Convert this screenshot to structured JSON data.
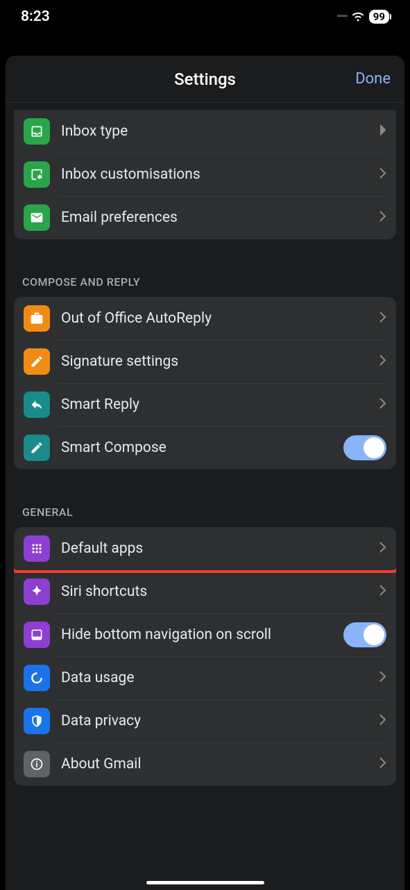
{
  "status": {
    "time": "8:23",
    "battery": "99"
  },
  "header": {
    "title": "Settings",
    "done": "Done"
  },
  "groups": [
    {
      "header": null,
      "items": [
        {
          "label": "Inbox type",
          "icon": "inbox-type",
          "color": "#2aa54a",
          "accessory": "chevron"
        },
        {
          "label": "Inbox customisations",
          "icon": "inbox-customisations",
          "color": "#2aa54a",
          "accessory": "chevron"
        },
        {
          "label": "Email preferences",
          "icon": "email",
          "color": "#2aa54a",
          "accessory": "chevron"
        }
      ]
    },
    {
      "header": "COMPOSE AND REPLY",
      "items": [
        {
          "label": "Out of Office AutoReply",
          "icon": "briefcase",
          "color": "#f08c16",
          "accessory": "chevron"
        },
        {
          "label": "Signature settings",
          "icon": "pen",
          "color": "#f08c16",
          "accessory": "chevron"
        },
        {
          "label": "Smart Reply",
          "icon": "reply",
          "color": "#1a8a8a",
          "accessory": "chevron"
        },
        {
          "label": "Smart Compose",
          "icon": "compose",
          "color": "#1a8a8a",
          "accessory": "toggle",
          "toggle_on": true
        }
      ]
    },
    {
      "header": "GENERAL",
      "items": [
        {
          "label": "Default apps",
          "icon": "apps-grid",
          "color": "#8c3fd0",
          "accessory": "chevron",
          "highlighted": true
        },
        {
          "label": "Siri shortcuts",
          "icon": "siri",
          "color": "#8c3fd0",
          "accessory": "chevron"
        },
        {
          "label": "Hide bottom navigation on scroll",
          "icon": "bottom-nav",
          "color": "#8c3fd0",
          "accessory": "toggle",
          "toggle_on": true
        },
        {
          "label": "Data usage",
          "icon": "data-usage",
          "color": "#1a73e8",
          "accessory": "chevron"
        },
        {
          "label": "Data privacy",
          "icon": "shield",
          "color": "#1a73e8",
          "accessory": "chevron"
        },
        {
          "label": "About Gmail",
          "icon": "info",
          "color": "#5f6368",
          "accessory": "chevron"
        }
      ]
    }
  ]
}
